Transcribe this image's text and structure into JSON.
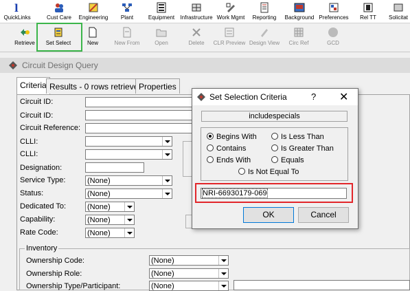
{
  "toolbar1": {
    "items": [
      "QuickLinks",
      "Cust Care",
      "Engineering",
      "Plant",
      "Equipment",
      "Infrastructure",
      "Work Mgmt",
      "Reporting",
      "Background",
      "Preferences",
      "Rel TT",
      "Solicitat"
    ]
  },
  "toolbar2": {
    "items": [
      "Retrieve",
      "Set Select",
      "New",
      "New From",
      "Open",
      "Delete",
      "CLR Preview",
      "Design View",
      "Circ Ref",
      "GCD"
    ]
  },
  "window": {
    "title": "Circuit Design Query"
  },
  "tabs": [
    "Criteria",
    "Results - 0 rows retrieved",
    "Properties"
  ],
  "form": {
    "labels": [
      "Circuit ID:",
      "Circuit ID:",
      "Circuit Reference:",
      "CLLI:",
      "CLLI:",
      "Designation:",
      "Service Type:",
      "Status:",
      "Dedicated To:",
      "Capability:",
      "Rate Code:"
    ],
    "service_type_value": "(None)",
    "status_value": "(None)",
    "dedicated_to_value": "(None)",
    "capability_value": "(None)",
    "rate_code_value": "(None)"
  },
  "inventory": {
    "legend": "Inventory",
    "labels": [
      "Ownership Code:",
      "Ownership Role:",
      "Ownership Type/Participant:"
    ],
    "values": [
      "(None)",
      "(None)",
      "(None)"
    ]
  },
  "dialog": {
    "title": "Set Selection Criteria",
    "help": "?",
    "close": "✕",
    "field_name": "includespecials",
    "options": [
      "Begins With",
      "Is Less Than",
      "Contains",
      "Is Greater Than",
      "Ends With",
      "Equals",
      "Is Not Equal To"
    ],
    "selected_option": "Begins With",
    "value": "NRI-66930179-069",
    "ok_label": "OK",
    "cancel_label": "Cancel"
  }
}
